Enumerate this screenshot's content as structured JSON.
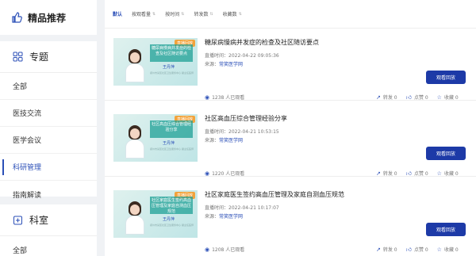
{
  "sidebar": {
    "top_title": "精品推荐",
    "topic_title": "专题",
    "topic_items": [
      "全部",
      "医技交流",
      "医学会议",
      "科研管理",
      "指南解读"
    ],
    "dept_title": "科室",
    "dept_items": [
      "全部"
    ]
  },
  "sortbar": [
    "默认",
    "按观看量",
    "按时间",
    "转发数",
    "收藏数"
  ],
  "items": [
    {
      "title": "糖尿病慢病并发症的检查及社区随访要点",
      "time_label": "直播时间：",
      "time": "2022-04-22 09:05:36",
      "src_label": "来源：",
      "source": "常笑医学网",
      "views": "1238 人已观看",
      "share": "转发 0",
      "like": "点赞 0",
      "fav": "收藏 0",
      "button": "观看回放",
      "tag": "直播回放",
      "thumb_title": "糖尿病慢病并发症的检查及社区随访要点",
      "speaker": "王丹萍",
      "thumb_sub": "郑州市某区社区卫生服务中心 副主任医师"
    },
    {
      "title": "社区高血压综合管理经验分享",
      "time_label": "直播时间：",
      "time": "2022-04-21 10:53:15",
      "src_label": "来源：",
      "source": "常笑医学网",
      "views": "1220 人已观看",
      "share": "转发 0",
      "like": "点赞 0",
      "fav": "收藏 0",
      "button": "观看回放",
      "tag": "直播回放",
      "thumb_title": "社区高血压综合管理经验分享",
      "speaker": "王丹萍",
      "thumb_sub": "郑州市某区社区卫生服务中心 副主任医师"
    },
    {
      "title": "社区家庭医生签约高血压管理及家庭自测血压规范",
      "time_label": "直播时间：",
      "time": "2022-04-21 10:17:07",
      "src_label": "来源：",
      "source": "常笑医学网",
      "views": "1208 人已观看",
      "share": "转发 0",
      "like": "点赞 0",
      "fav": "收藏 0",
      "button": "观看回放",
      "tag": "直播回放",
      "thumb_title": "社区家庭医生签约高血压管理及家庭自测血压规范",
      "speaker": "王丹萍",
      "thumb_sub": "郑州市某区社区卫生服务中心 副主任医师"
    }
  ],
  "colors": {
    "accent": "#2b4fb7",
    "button": "#1d3aa7",
    "tag": "#f2a33c"
  }
}
